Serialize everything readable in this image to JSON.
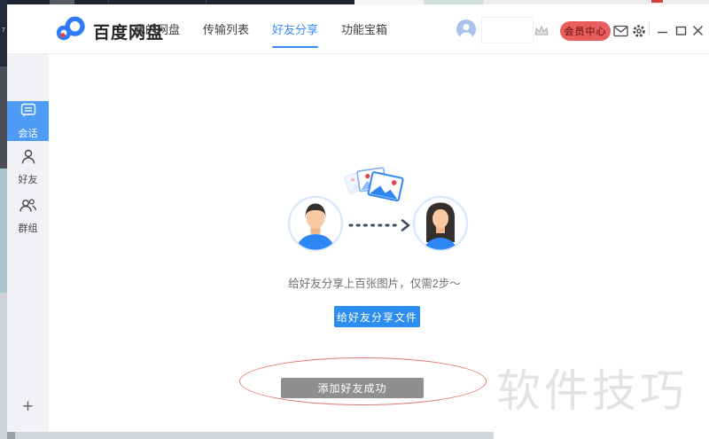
{
  "header": {
    "app_name": "百度网盘",
    "tabs": [
      {
        "label": "我的网盘",
        "active": false
      },
      {
        "label": "传输列表",
        "active": false
      },
      {
        "label": "好友分享",
        "active": true
      },
      {
        "label": "功能宝箱",
        "active": false
      }
    ],
    "vip_button_label": "会员中心",
    "icons": {
      "logo": "baidu-pan-cloud",
      "user_avatar": "person-silhouette",
      "crown": "crown",
      "mail": "envelope",
      "settings": "gear",
      "minimize": "minimize-line",
      "maximize": "maximize-square",
      "close": "close-x"
    }
  },
  "sidebar": {
    "items": [
      {
        "label": "会话",
        "icon": "chat-bubble-icon",
        "active": true
      },
      {
        "label": "好友",
        "icon": "person-icon",
        "active": false
      },
      {
        "label": "群组",
        "icon": "people-icon",
        "active": false
      }
    ],
    "add_button_label": "+"
  },
  "main": {
    "caption": "给好友分享上百张图片，仅需2步～",
    "share_button_label": "给好友分享文件",
    "toast_label": "添加好友成功",
    "illustration": {
      "icons": [
        "photo-stack",
        "man-avatar",
        "dotted-arrow",
        "woman-avatar"
      ]
    }
  },
  "annotation": {
    "shape": "ellipse",
    "color": "#d9564a"
  },
  "watermark": {
    "text": "软件技巧"
  },
  "background": {
    "left_edge_fragment": "7"
  },
  "colors": {
    "accent_blue": "#3b8cfa",
    "sidebar_active_blue": "#4f9cf7",
    "primary_button_blue": "#2d8cf0",
    "toast_gray": "#8f8f8f",
    "vip_red": "#e85e5e",
    "annotation_red": "#d9564a",
    "watermark_gray": "#e3e3e3"
  }
}
